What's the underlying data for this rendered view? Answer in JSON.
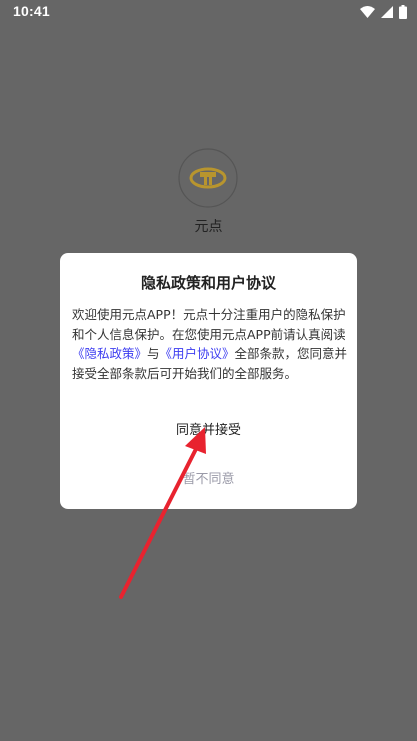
{
  "status_bar": {
    "time": "10:41",
    "icons": [
      "wifi-icon",
      "signal-icon",
      "battery-icon"
    ]
  },
  "splash": {
    "app_name": "元点"
  },
  "dialog": {
    "title": "隐私政策和用户协议",
    "body_intro": "欢迎使用元点APP！元点十分注重用户的隐私保护和个人信息保护。在您使用元点APP前请认真阅读",
    "privacy_link": "《隐私政策》",
    "conjunction": "与",
    "terms_link": "《用户协议》",
    "body_outro": "全部条款，您同意并接受全部条款后可开始我们的全部服务。",
    "agree_label": "同意并接受",
    "disagree_label": "暂不同意"
  },
  "colors": {
    "overlay_background": "#666666",
    "link": "#3d3df0",
    "disagree_text": "#9a9aa8",
    "annotation_arrow": "#e8232f",
    "logo_gold": "#b8952e"
  }
}
